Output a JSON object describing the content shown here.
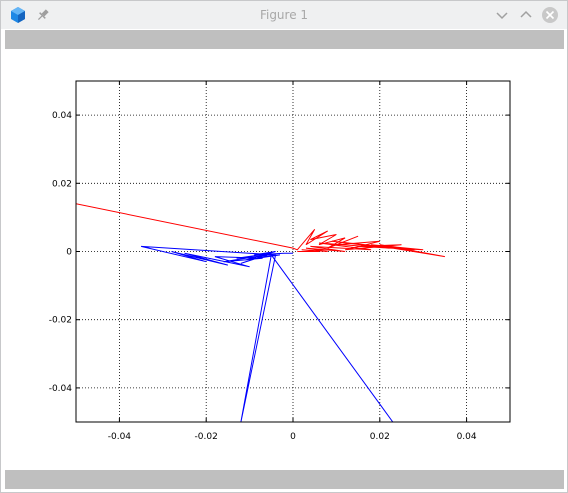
{
  "window": {
    "title": "Figure 1"
  },
  "icons": {
    "app": "octave-cube-icon",
    "pin": "pin-icon",
    "minimize": "chevron-down-icon",
    "maximize": "chevron-up-icon",
    "close": "close-icon"
  },
  "chart_data": {
    "type": "line",
    "xlim": [
      -0.05,
      0.05
    ],
    "ylim": [
      -0.05,
      0.05
    ],
    "grid": true,
    "xticks": [
      "-0.04",
      "-0.02",
      "0",
      "0.02",
      "0.04"
    ],
    "xtick_values": [
      -0.04,
      -0.02,
      0,
      0.02,
      0.04
    ],
    "yticks": [
      "0.04",
      "0.02",
      "0",
      "-0.02",
      "-0.04"
    ],
    "ytick_values": [
      0.04,
      0.02,
      0,
      -0.02,
      -0.04
    ],
    "series": [
      {
        "color": "#ff0000",
        "x": [
          -0.05,
          0.0,
          0.001,
          0.005,
          0.003,
          0.008,
          0.004,
          0.01,
          0.006,
          0.012,
          0.008,
          0.015,
          0.01,
          0.02,
          0.012,
          0.025,
          0.015,
          0.03,
          0.018,
          0.035,
          0.02,
          0.028,
          0.009,
          0.022,
          0.006,
          0.018,
          0.004,
          0.012,
          0.003,
          0.008,
          0.002,
          0.006,
          0.001
        ],
        "y": [
          0.014,
          0.001,
          0.0005,
          0.0065,
          0.002,
          0.006,
          0.0035,
          0.005,
          0.002,
          0.004,
          0.001,
          0.0045,
          0.002,
          0.003,
          0.0005,
          0.002,
          0.0015,
          0.0005,
          0.002,
          -0.0015,
          0.002,
          0.0005,
          0.003,
          0.001,
          0.0025,
          0.0005,
          0.0015,
          0.0,
          0.001,
          0.0,
          0.0005,
          0.0,
          0.0
        ]
      },
      {
        "color": "#0000ff",
        "x": [
          0.023,
          -0.005,
          -0.012,
          -0.004,
          -0.035,
          -0.02,
          -0.028,
          -0.015,
          -0.025,
          -0.01,
          -0.018,
          -0.007,
          -0.016,
          -0.006,
          -0.012,
          -0.005,
          -0.013,
          -0.003,
          -0.011,
          -0.004,
          -0.009,
          -0.002,
          0.0
        ],
        "y": [
          -0.05,
          -0.001,
          -0.05,
          -0.001,
          0.0015,
          -0.003,
          0.0,
          -0.004,
          -0.0005,
          -0.0045,
          -0.0015,
          -0.002,
          -0.003,
          -0.001,
          -0.0035,
          -0.0005,
          -0.002,
          -0.001,
          -0.0025,
          0.0,
          -0.001,
          -0.0005,
          -0.0005
        ]
      }
    ]
  }
}
